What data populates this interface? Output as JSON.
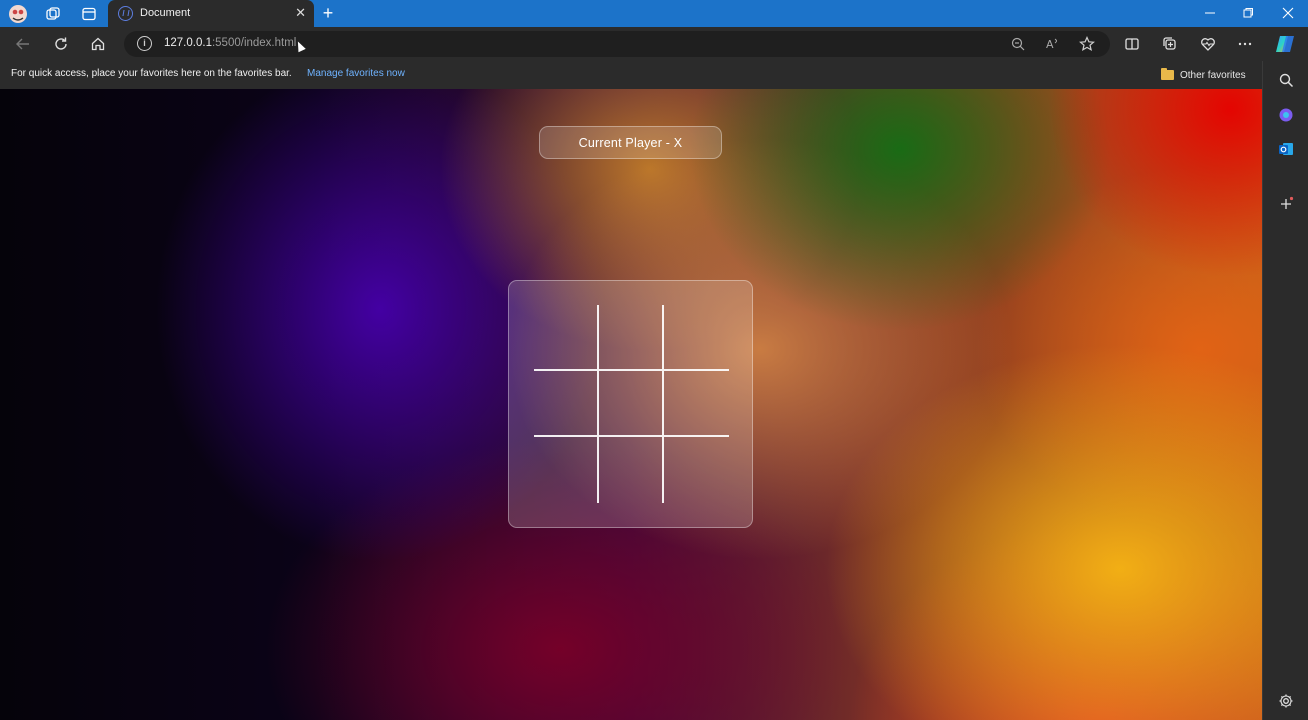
{
  "browser": {
    "tab": {
      "title": "Document",
      "close": "✕"
    },
    "new_tab": "+",
    "window": {
      "minimize": "—",
      "restore": "❐",
      "close": "✕"
    },
    "address": {
      "host": "127.0.0.1",
      "rest": ":5500/index.html"
    },
    "favorites_bar": {
      "message": "For quick access, place your favorites here on the favorites bar.",
      "link": "Manage favorites now",
      "other": "Other favorites"
    },
    "accent_color": "#1c73c9"
  },
  "game": {
    "status": "Current Player - X",
    "cells": [
      "",
      "",
      "",
      "",
      "",
      "",
      "",
      "",
      ""
    ]
  }
}
